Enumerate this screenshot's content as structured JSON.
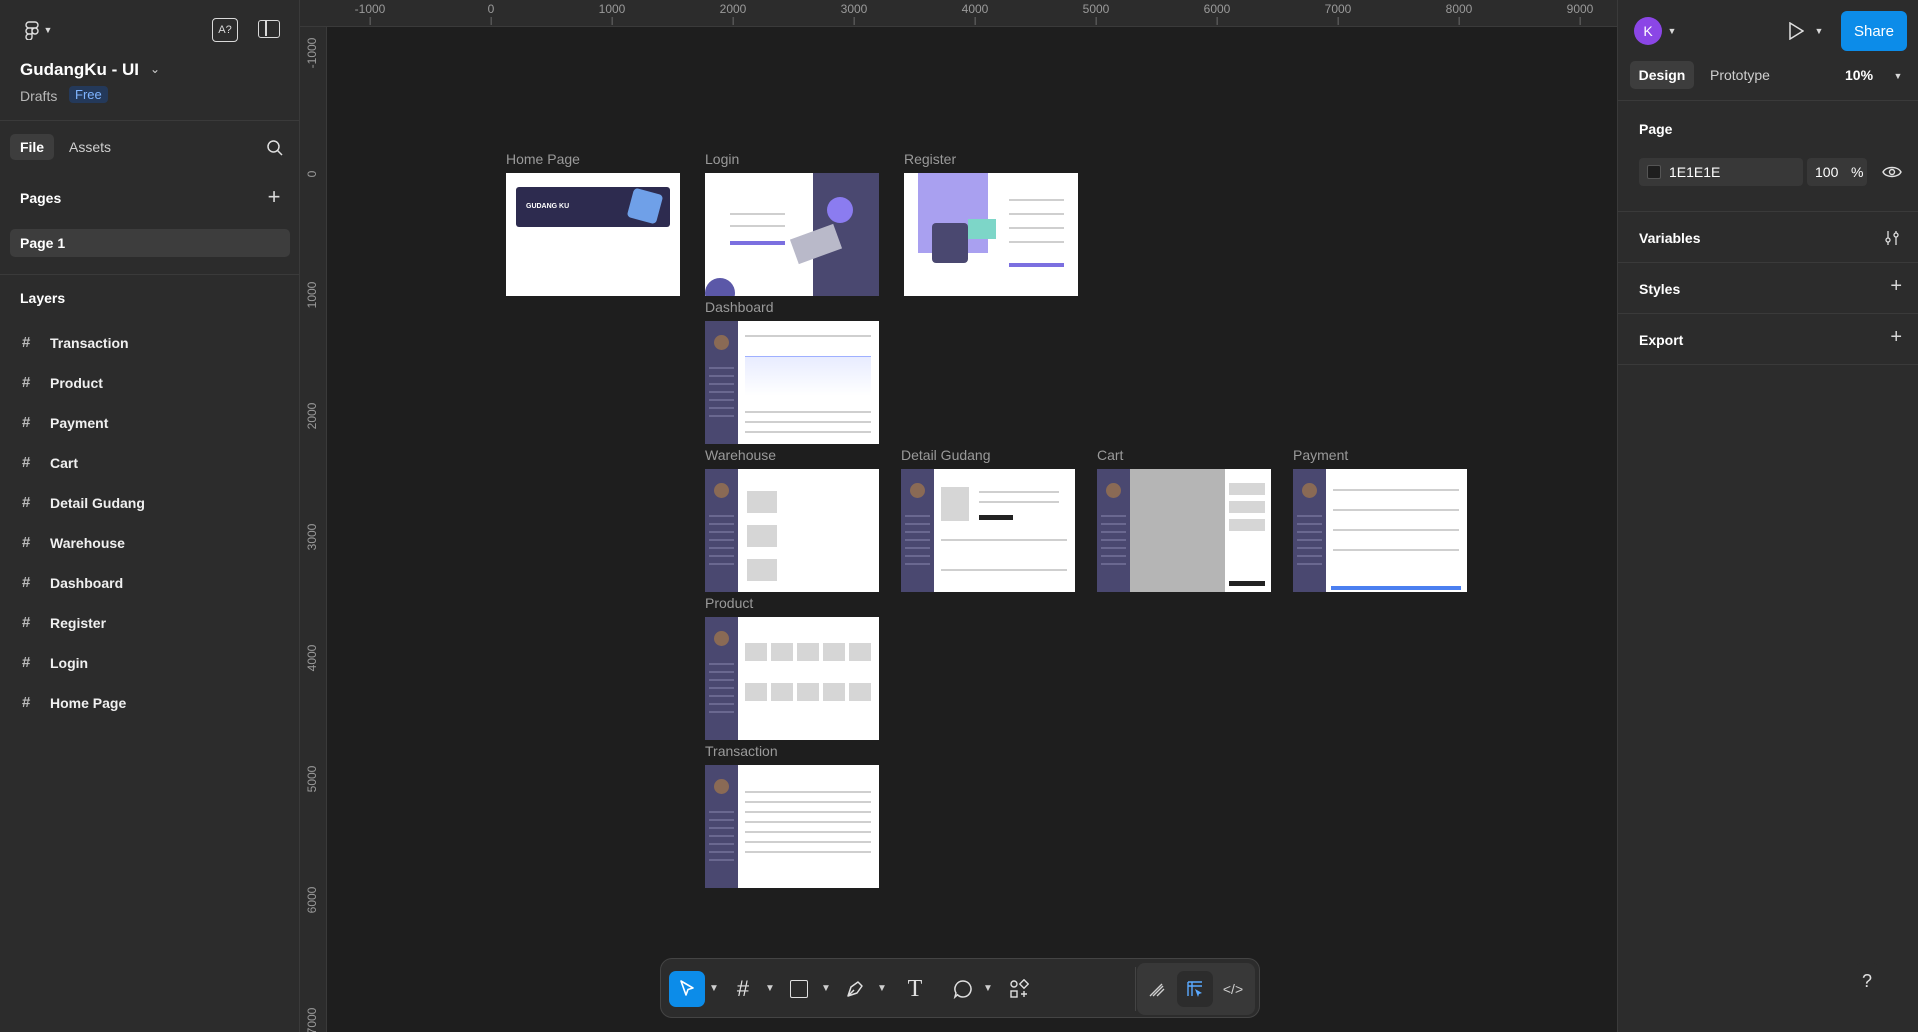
{
  "file": {
    "title": "GudangKu - UI",
    "location": "Drafts",
    "plan_badge": "Free"
  },
  "left_tabs": {
    "file": "File",
    "assets": "Assets"
  },
  "pages": {
    "heading": "Pages",
    "items": [
      "Page 1"
    ]
  },
  "layers": {
    "heading": "Layers",
    "items": [
      "Transaction",
      "Product",
      "Payment",
      "Cart",
      "Detail Gudang",
      "Warehouse",
      "Dashboard",
      "Register",
      "Login",
      "Home Page"
    ]
  },
  "ruler": {
    "top_ticks": [
      "-1000",
      "0",
      "1000",
      "2000",
      "3000",
      "4000",
      "5000",
      "6000",
      "7000",
      "8000",
      "9000"
    ],
    "left_ticks": [
      "-1000",
      "0",
      "1000",
      "2000",
      "3000",
      "4000",
      "5000",
      "6000",
      "7000"
    ]
  },
  "frames": {
    "home": "Home Page",
    "login": "Login",
    "register": "Register",
    "dashboard": "Dashboard",
    "warehouse": "Warehouse",
    "detail": "Detail Gudang",
    "cart": "Cart",
    "payment": "Payment",
    "product": "Product",
    "transaction": "Transaction",
    "home_banner_text": "GUDANG KU"
  },
  "right_panel": {
    "user_initial": "K",
    "share": "Share",
    "tab_design": "Design",
    "tab_prototype": "Prototype",
    "zoom": "10%",
    "page_heading": "Page",
    "bg_hex": "1E1E1E",
    "bg_opacity": "100",
    "percent": "%",
    "variables": "Variables",
    "styles": "Styles",
    "export": "Export"
  },
  "help": "?",
  "colors": {
    "accent": "#0c8ce9",
    "canvas": "#1e1e1e",
    "panel": "#2c2c2c",
    "sidebar_frame": "#4a4870",
    "avatar": "#8b46e6"
  }
}
